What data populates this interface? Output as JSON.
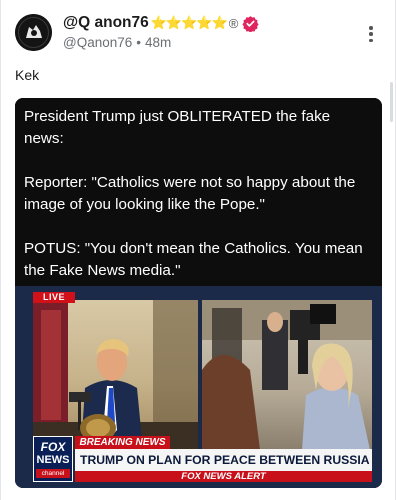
{
  "post": {
    "display_name": "@Q anon76",
    "name_emoji": "⭐⭐⭐⭐⭐",
    "registered_mark": "®",
    "handle": "@Qanon76",
    "separator": "•",
    "time": "48m",
    "text": "Kek"
  },
  "quote": {
    "paragraphs": [
      "President Trump just OBLITERATED the fake news:",
      "Reporter: \"Catholics were not so happy about the image of you looking like the Pope.\"",
      "POTUS: \"You don't mean the Catholics. You mean the Fake News media.\""
    ]
  },
  "broadcast": {
    "live_label": "LIVE",
    "breaking_label": "BREAKING NEWS",
    "headline": "TRUMP ON PLAN FOR PEACE BETWEEN RUSSIA & UKRAINE",
    "ticker": "FOX NEWS ALERT",
    "logo_line1": "FOX",
    "logo_line2": "NEWS",
    "logo_line3": "channel"
  },
  "icons": {
    "avatar": "avatar-image",
    "verified": "verified-badge-icon",
    "more": "more-options-icon"
  },
  "colors": {
    "verified_badge": "#e0245e",
    "star": "#f5c518",
    "fox_red": "#c8101a",
    "fox_navy": "#0a1f56"
  }
}
